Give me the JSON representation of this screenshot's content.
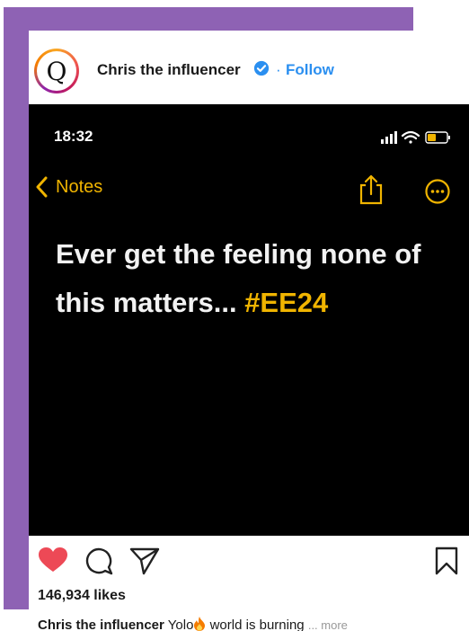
{
  "header": {
    "avatar_letter": "Q",
    "username": "Chris the influencer",
    "separator": "·",
    "follow_label": "Follow"
  },
  "phone": {
    "status_time": "18:32",
    "back_label": "Notes",
    "note_text": "Ever get the feeling none of this matters...",
    "hashtag": "#EE24"
  },
  "post": {
    "likes": "146,934 likes",
    "caption_user": "Chris the influencer",
    "caption_text": "Yolo",
    "caption_text_after": "world is burning",
    "more_label": "... more"
  },
  "colors": {
    "accent_blue": "#2b8ff0",
    "notes_yellow": "#f0b400",
    "like_red": "#ed4956",
    "frame_purple": "#8e62b4"
  },
  "icons": [
    "verified-badge-icon",
    "back-chevron-icon",
    "share-icon",
    "more-options-icon",
    "heart-icon",
    "comment-icon",
    "send-icon",
    "bookmark-icon",
    "signal-icon",
    "wifi-icon",
    "battery-icon",
    "fire-emoji-icon"
  ]
}
